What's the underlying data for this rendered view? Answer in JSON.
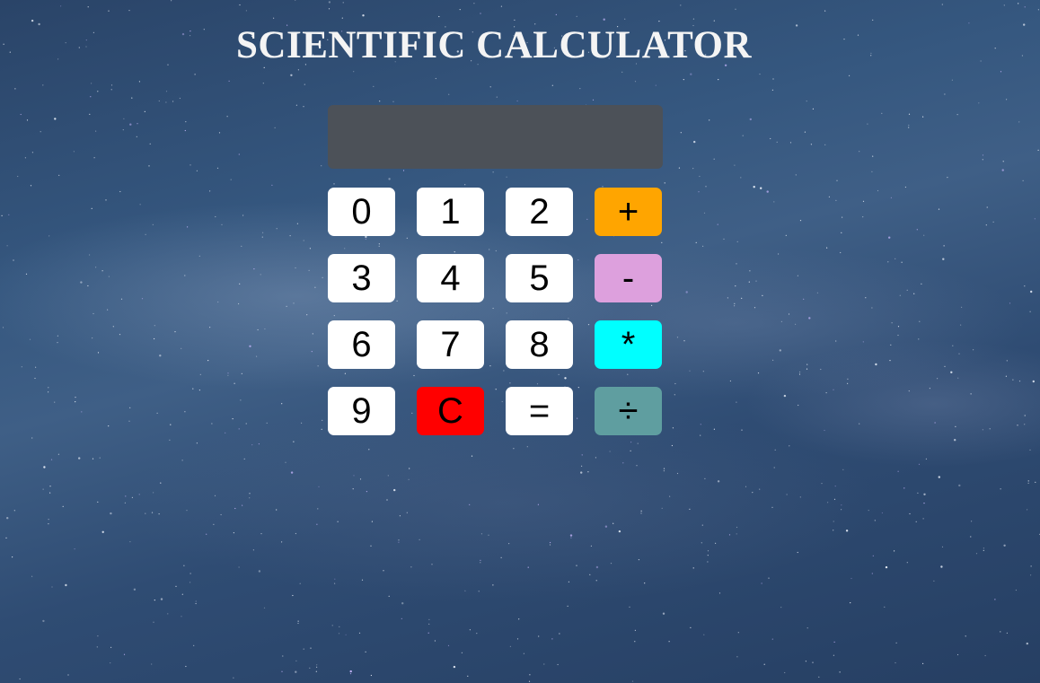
{
  "title": "SCIENTIFIC CALCULATOR",
  "display": {
    "value": ""
  },
  "keys": [
    {
      "label": "0",
      "name": "key-0",
      "color": "#ffffff"
    },
    {
      "label": "1",
      "name": "key-1",
      "color": "#ffffff"
    },
    {
      "label": "2",
      "name": "key-2",
      "color": "#ffffff"
    },
    {
      "label": "+",
      "name": "key-plus",
      "color": "#ffa500"
    },
    {
      "label": "3",
      "name": "key-3",
      "color": "#ffffff"
    },
    {
      "label": "4",
      "name": "key-4",
      "color": "#ffffff"
    },
    {
      "label": "5",
      "name": "key-5",
      "color": "#ffffff"
    },
    {
      "label": "-",
      "name": "key-minus",
      "color": "#dda0dd"
    },
    {
      "label": "6",
      "name": "key-6",
      "color": "#ffffff"
    },
    {
      "label": "7",
      "name": "key-7",
      "color": "#ffffff"
    },
    {
      "label": "8",
      "name": "key-8",
      "color": "#ffffff"
    },
    {
      "label": "*",
      "name": "key-multiply",
      "color": "#00ffff"
    },
    {
      "label": "9",
      "name": "key-9",
      "color": "#ffffff"
    },
    {
      "label": "C",
      "name": "key-clear",
      "color": "#ff0000"
    },
    {
      "label": "=",
      "name": "key-equals",
      "color": "#ffffff"
    },
    {
      "label": "÷",
      "name": "key-divide",
      "color": "#5f9ea0"
    }
  ]
}
